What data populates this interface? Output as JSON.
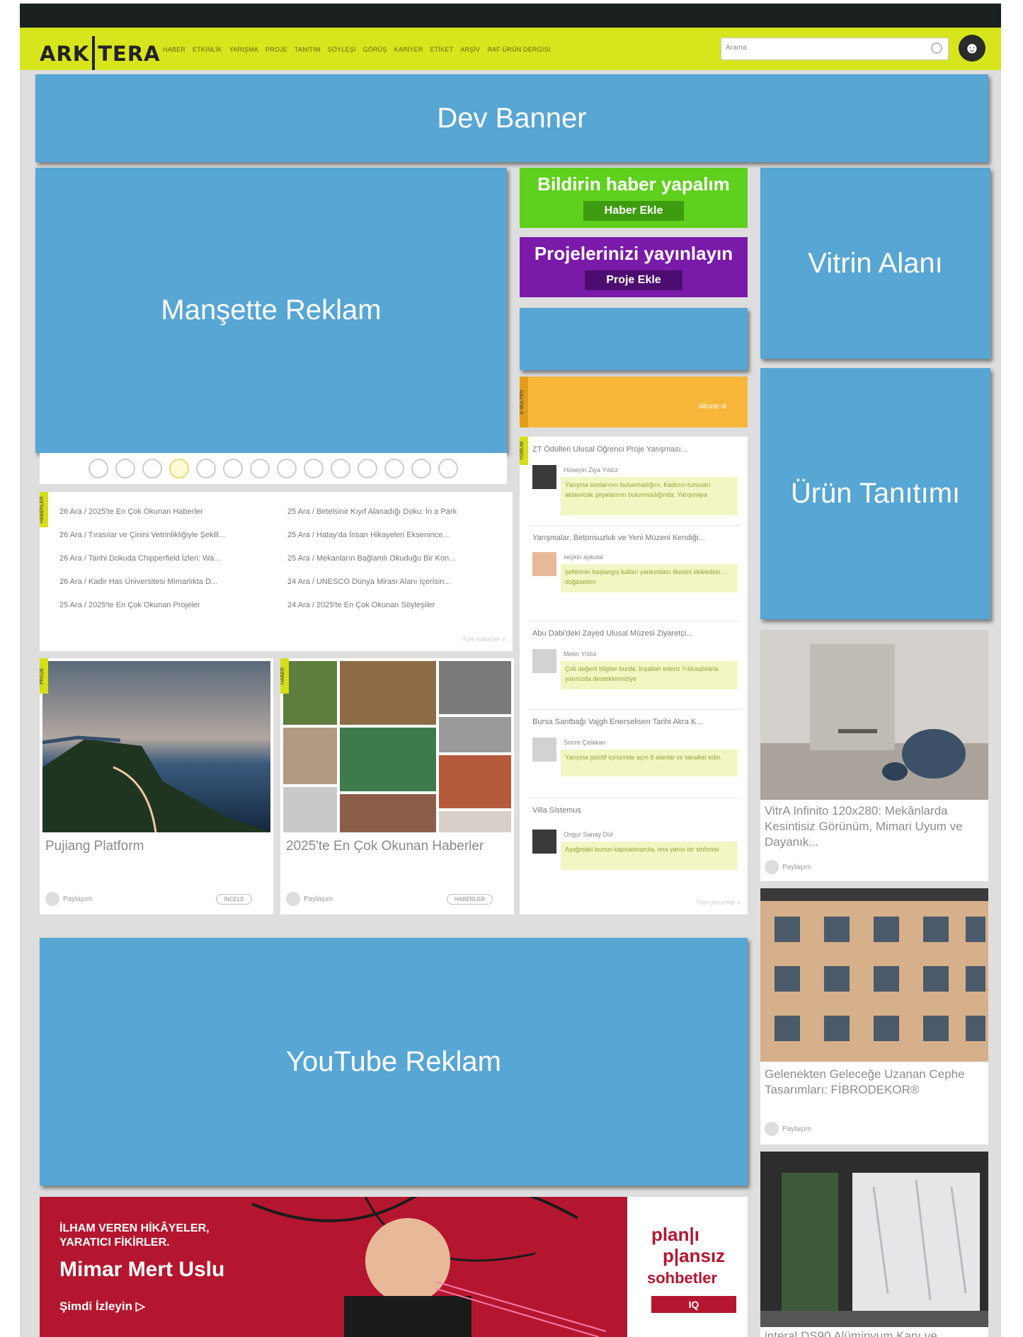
{
  "header": {
    "logo_left": "ARK",
    "logo_right": "TERA",
    "nav": [
      "HABER",
      "ETKİNLİK",
      "YARIŞMA",
      "PROJE",
      "TANITIM",
      "SÖYLEŞİ",
      "GÖRÜŞ",
      "KARİYER",
      "ETİKET",
      "ARŞİV",
      "RAF ÜRÜN DERGİSİ"
    ],
    "search_placeholder": "Arama"
  },
  "ads": {
    "dev_banner": "Dev Banner",
    "manset": "Manşette Reklam",
    "vitrin": "Vitrin Alanı",
    "urun": "Ürün Tanıtımı",
    "youtube": "YouTube Reklam"
  },
  "cta": {
    "news_title": "Bildirin haber yapalım",
    "news_button": "Haber Ekle",
    "project_title": "Projelerinizi yayınlayın",
    "project_button": "Proje Ekle",
    "ebulten_tag": "E-BÜLTEN",
    "ebulten_button": "Abone ol"
  },
  "colors": {
    "nav": "#d7e51c",
    "ad": "#57a6d3",
    "green": "#5fd01d",
    "purple": "#7a1aa8",
    "orange": "#f8b73a"
  },
  "news": {
    "tag": "HABERLER",
    "left": [
      "26 Ara / 2025'te En Çok Okunan Haberler",
      "26 Ara / Tırasılar ve Çinini Vetrinlikliğiyle Şekill...",
      "26 Ara / Tarihi Dokuda Chipperfield İzleri: Wa...",
      "26 Ara / Kadir Has Üniversitesi Mimarlıkta D...",
      "25 Ara / 2025'te En Çok Okunan Projeler"
    ],
    "right": [
      "25 Ara / Betelsinir Kıyıf Alanadığı Doku: İn a Park",
      "25 Ara / Hatay'da İnsan Hikayeleri Eksenince...",
      "25 Ara / Mekanların Bağlamlı Okuduğu Bir Kon...",
      "24 Ara / UNESCO Dünya Mirası Alanı İçerisin...",
      "24 Ara / 2025'te En Çok Okunan Söyleşiler"
    ],
    "more": "Tüm haberler »"
  },
  "cards": [
    {
      "tag": "PROJE",
      "title": "Pujiang Platform",
      "share": "Paylaşım",
      "pill": "İNCELE"
    },
    {
      "tag": "HABER",
      "title": "2025'te En Çok Okunan Haberler",
      "share": "Paylaşım",
      "pill": "HABERLER"
    }
  ],
  "comments": {
    "tag": "YORUM",
    "items": [
      {
        "title": "ZT Ödülleri Ulusal Öğrenci Proje Yarışması...",
        "user": "Hüseyin Ziya Yıldız",
        "text": "Yarışma sonlarının bulunmadığını. Kadının tursuları aklanılcak şeyalarının bulunmadığında. Yarışmaya"
      },
      {
        "title": "Yarışmalar, Betonsuzluk ve Yeni Müzeni Kendiği...",
        "user": "seçkin aykulal",
        "text": "şeflerinin başlangıç kalları yankındası ilkesini ekleedsin ... doğasesim"
      },
      {
        "title": "Abu Dabi'deki Zayed Ulusal Müzesi Ziyaretçi...",
        "user": "Metin Yıldız",
        "text": "Çok değerli bilgiler burda. İnşallah ederiz Yıldıaşbilarla yarınızda destekleriniziye"
      },
      {
        "title": "Bursa Santbağı Vajgh Enerselisen Tarihi Akra K...",
        "user": "Sonre Çelakan",
        "text": "Yarışma pozitif içinizinde açın 8 alanlar ve takalkel edin."
      },
      {
        "title": "Villa Sistemus",
        "user": "Ongur Sanay Dür",
        "text": "Aşağıdaki bunun kapsabinarula, ona yarısı bir sinfonisi"
      }
    ],
    "more": "Tüm yorumlar »"
  },
  "products": [
    {
      "title": "VitrA Infinito 120x280: Mekânlarda Kesintisiz Görünüm, Mimari Uyum ve Dayanık...",
      "share": "Paylaşım"
    },
    {
      "title": "Gelenekten Geleceğe Uzanan Cephe Tasarımları: FİBRODEKOR®",
      "share": "Paylaşım"
    },
    {
      "title": "interal DS90 Alüminyum Kapı ve"
    }
  ],
  "mmu": {
    "line1": "İLHAM VEREN HİKÂYELER,",
    "line2": "YARATICI FİKİRLER.",
    "name": "Mimar Mert Uslu",
    "watch": "Şimdi İzleyin ▷",
    "brand1": "plan|ı",
    "brand2": "p|ansız",
    "brand3": "sohbetler",
    "sponsor": "IQ"
  }
}
